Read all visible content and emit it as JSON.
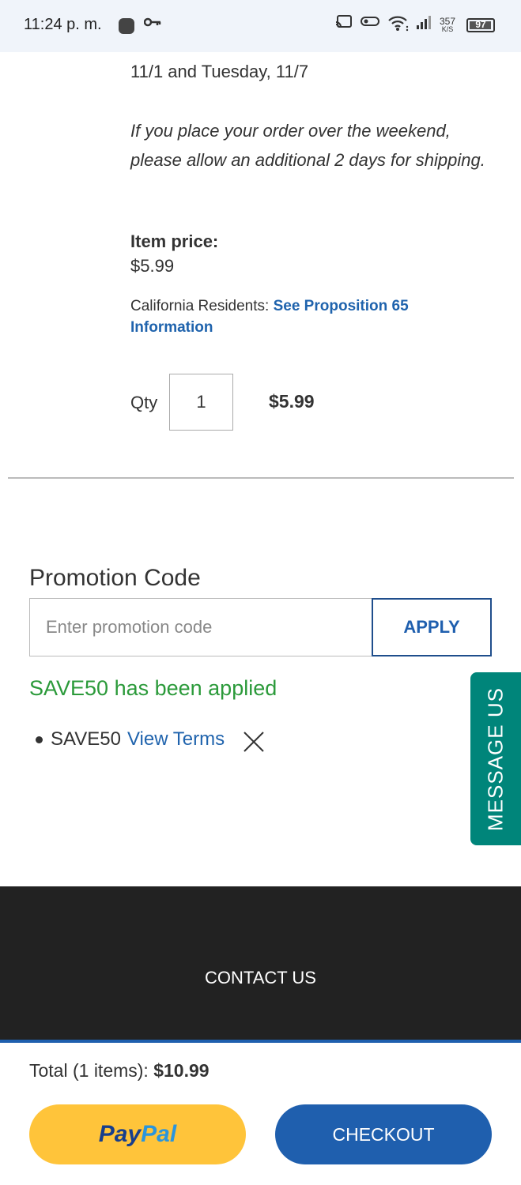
{
  "status_bar": {
    "time": "11:24 p. m.",
    "speed_value": "357",
    "speed_unit": "K/S",
    "battery": "97",
    "battery_level": 0.97,
    "icons": [
      "key-icon",
      "cast-icon",
      "vpn-key-icon",
      "wifi-icon",
      "signal-icon",
      "battery-icon"
    ]
  },
  "order": {
    "delivery_dates": "11/1 and Tuesday, 11/7",
    "weekend_note": "If you place your order over the weekend, please allow an additional 2 days for shipping.",
    "item_price_label": "Item price:",
    "item_price": "$5.99",
    "prop65_prefix": "California Residents: ",
    "prop65_link": "See Proposition 65 Information",
    "qty_label": "Qty",
    "qty_value": "1",
    "line_total": "$5.99"
  },
  "promotion": {
    "heading": "Promotion Code",
    "input_placeholder": "Enter promotion code",
    "input_value": "",
    "apply_label": "APPLY",
    "success_message": "SAVE50 has been applied",
    "applied_code": "SAVE50",
    "view_terms_label": "View Terms"
  },
  "message_us": {
    "label": "MESSAGE US",
    "color": "#00857a"
  },
  "footer": {
    "contact_label": "CONTACT US"
  },
  "cart": {
    "total_label": "Total (1 items): ",
    "total_value": "$10.99",
    "paypal_pay": "Pay",
    "paypal_pal": "Pal",
    "checkout_label": "CHECKOUT",
    "colors": {
      "accent": "#1f5fae",
      "paypal_yellow": "#ffc43a",
      "success": "#2b9a3a"
    }
  }
}
